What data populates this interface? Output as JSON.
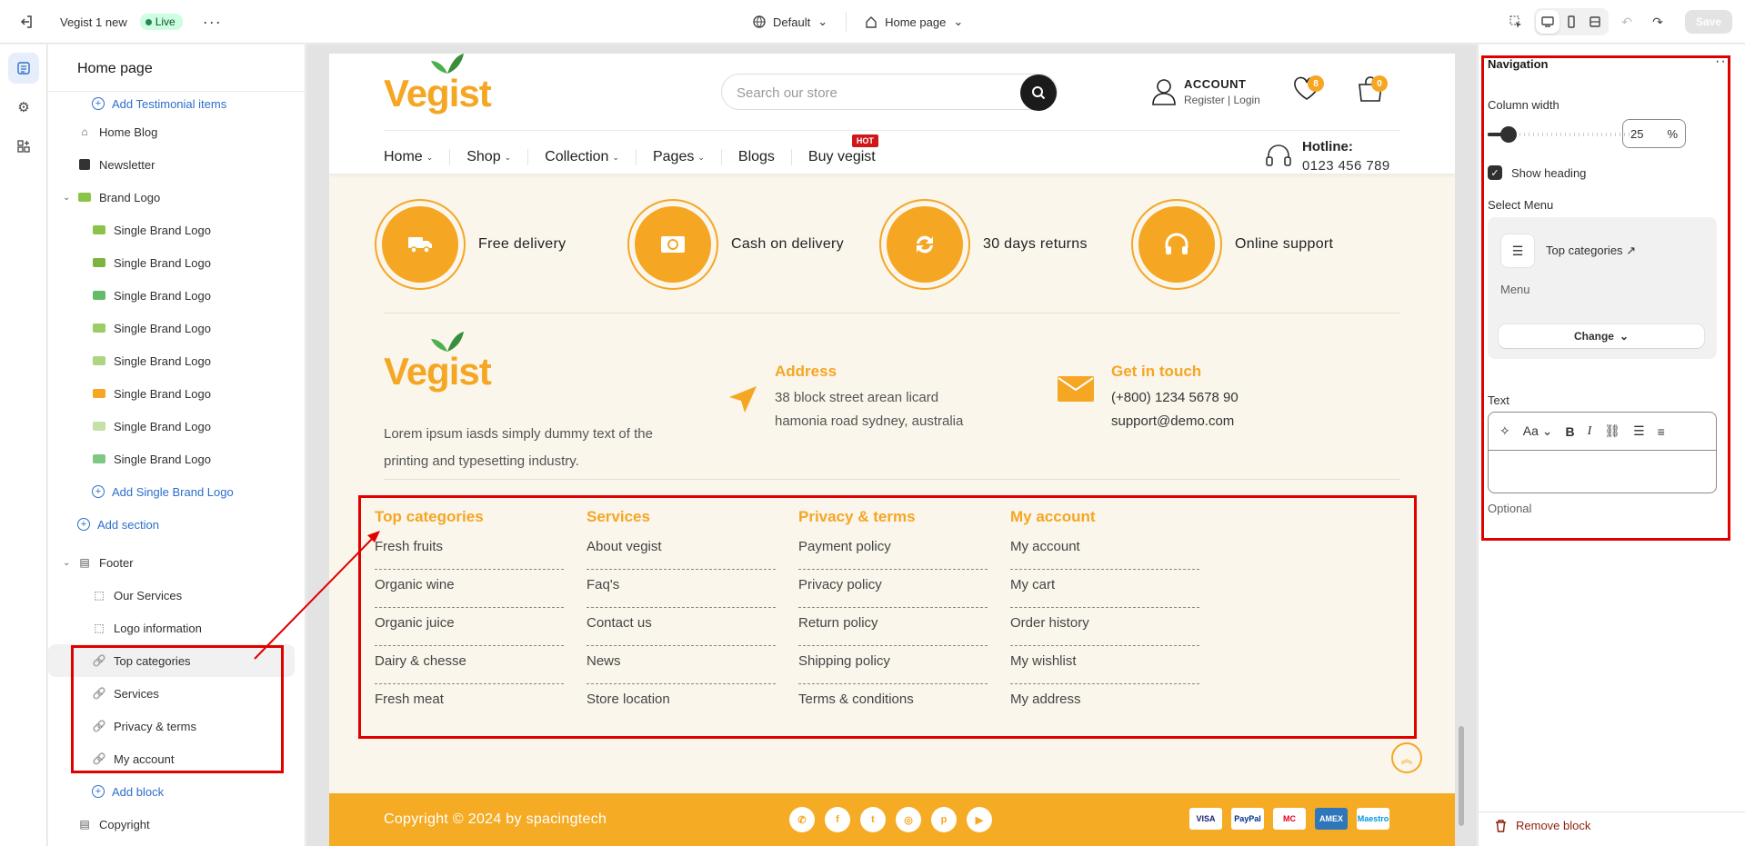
{
  "topbar": {
    "theme_name": "Vegist 1 new",
    "live_label": "Live",
    "device_select": "Default",
    "page_select": "Home page",
    "save_label": "Save"
  },
  "sidebar": {
    "title": "Home page",
    "items": [
      {
        "label": "Add Testimonial items",
        "kind": "add",
        "level": 2
      },
      {
        "label": "Home Blog",
        "kind": "section",
        "level": 1
      },
      {
        "label": "Newsletter",
        "kind": "section",
        "level": 1
      },
      {
        "label": "Brand Logo",
        "kind": "section",
        "level": 1
      },
      {
        "label": "Single Brand Logo",
        "kind": "block",
        "level": 2
      },
      {
        "label": "Single Brand Logo",
        "kind": "block",
        "level": 2
      },
      {
        "label": "Single Brand Logo",
        "kind": "block",
        "level": 2
      },
      {
        "label": "Single Brand Logo",
        "kind": "block",
        "level": 2
      },
      {
        "label": "Single Brand Logo",
        "kind": "block",
        "level": 2
      },
      {
        "label": "Single Brand Logo",
        "kind": "block",
        "level": 2
      },
      {
        "label": "Single Brand Logo",
        "kind": "block",
        "level": 2
      },
      {
        "label": "Single Brand Logo",
        "kind": "block",
        "level": 2
      },
      {
        "label": "Add Single Brand Logo",
        "kind": "add",
        "level": 2
      },
      {
        "label": "Add section",
        "kind": "add",
        "level": 1
      },
      {
        "label": "Footer",
        "kind": "section",
        "level": 1
      },
      {
        "label": "Our Services",
        "kind": "block",
        "level": 2
      },
      {
        "label": "Logo information",
        "kind": "block",
        "level": 2
      },
      {
        "label": "Top categories",
        "kind": "link",
        "level": 2
      },
      {
        "label": "Services",
        "kind": "link",
        "level": 2
      },
      {
        "label": "Privacy & terms",
        "kind": "link",
        "level": 2
      },
      {
        "label": "My account",
        "kind": "link",
        "level": 2
      },
      {
        "label": "Add block",
        "kind": "add",
        "level": 2
      },
      {
        "label": "Copyright",
        "kind": "section",
        "level": 1
      }
    ]
  },
  "store": {
    "logo": "Vegist",
    "search_placeholder": "Search our store",
    "account_title": "ACCOUNT",
    "register": "Register",
    "login": "Login",
    "wishlist_count": "8",
    "cart_count": "0",
    "nav": [
      {
        "label": "Home",
        "dropdown": true
      },
      {
        "label": "Shop",
        "dropdown": true
      },
      {
        "label": "Collection",
        "dropdown": true
      },
      {
        "label": "Pages",
        "dropdown": true
      },
      {
        "label": "Blogs",
        "dropdown": false
      },
      {
        "label": "Buy vegist",
        "dropdown": false
      }
    ],
    "hot_badge": "HOT",
    "hotline_label": "Hotline:",
    "hotline_number": "0123 456 789",
    "services": [
      "Free delivery",
      "Cash on delivery",
      "30 days returns",
      "Online support"
    ],
    "about_text": "Lorem ipsum iasds simply dummy text of the printing and typesetting industry.",
    "address_title": "Address",
    "address_line1": "38 block street arean licard",
    "address_line2": "hamonia road sydney, australia",
    "contact_title": "Get in touch",
    "contact_phone": "(+800) 1234 5678 90",
    "contact_email": "support@demo.com",
    "footer_columns": [
      {
        "title": "Top categories",
        "links": [
          "Fresh fruits",
          "Organic wine",
          "Organic juice",
          "Dairy & chesse",
          "Fresh meat"
        ]
      },
      {
        "title": "Services",
        "links": [
          "About vegist",
          "Faq's",
          "Contact us",
          "News",
          "Store location"
        ]
      },
      {
        "title": "Privacy & terms",
        "links": [
          "Payment policy",
          "Privacy policy",
          "Return policy",
          "Shipping policy",
          "Terms & conditions"
        ]
      },
      {
        "title": "My account",
        "links": [
          "My account",
          "My cart",
          "Order history",
          "My wishlist",
          "My address"
        ]
      }
    ],
    "copyright": "Copyright © 2024 by spacingtech",
    "payments": [
      "VISA",
      "PayPal",
      "MC",
      "AMEX",
      "Maestro"
    ],
    "brand_color": "#f5a623"
  },
  "settings": {
    "title": "Navigation",
    "column_width_label": "Column width",
    "column_width_value": "25",
    "column_width_unit": "%",
    "column_width_fraction": 0.25,
    "show_heading_label": "Show heading",
    "show_heading_checked": true,
    "select_menu_label": "Select Menu",
    "menu_name": "Top categories",
    "menu_sub": "Menu",
    "change_label": "Change",
    "text_label": "Text",
    "optional_label": "Optional",
    "remove_label": "Remove block"
  }
}
